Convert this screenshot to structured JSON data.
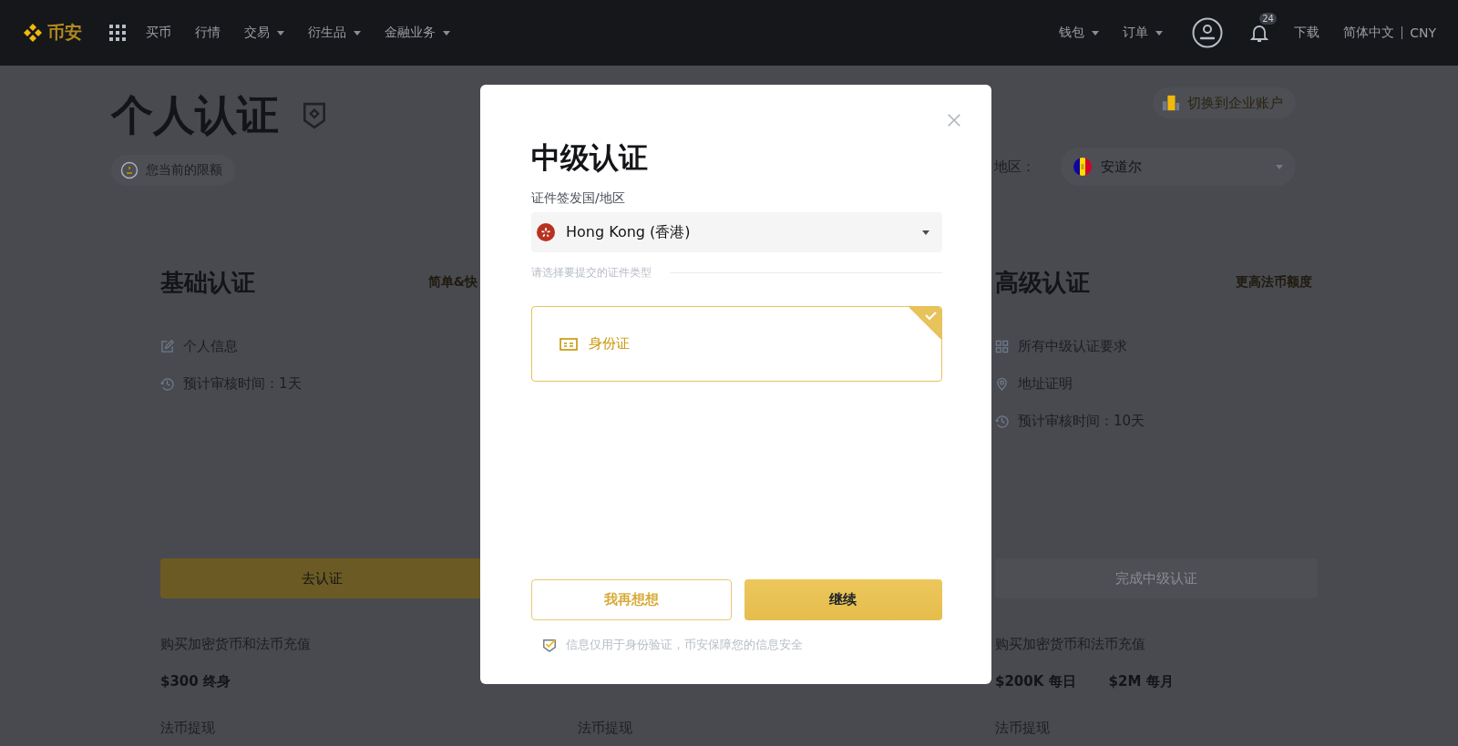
{
  "nav": {
    "logo": "币安",
    "menu": [
      {
        "label": "买币",
        "dropdown": false
      },
      {
        "label": "行情",
        "dropdown": false
      },
      {
        "label": "交易",
        "dropdown": true
      },
      {
        "label": "衍生品",
        "dropdown": true
      },
      {
        "label": "金融业务",
        "dropdown": true
      }
    ],
    "right_menu": [
      {
        "label": "钱包",
        "dropdown": true
      },
      {
        "label": "订单",
        "dropdown": true
      }
    ],
    "notification_count": "24",
    "download": "下载",
    "language": "简体中文",
    "currency": "CNY"
  },
  "page": {
    "title": "个人认证",
    "limit_chip": "您当前的限额",
    "switch_account": "切换到企业账户",
    "region_label": "地区：",
    "region_value": "安道尔"
  },
  "levels": [
    {
      "title": "基础认证",
      "tag": "简单&快",
      "requirements": [
        {
          "kind": "edit",
          "text": "个人信息"
        },
        {
          "kind": "clock",
          "text": "预计审核时间：1天"
        }
      ],
      "button": {
        "label": "去认证",
        "disabled": false
      },
      "limits_title": "购买加密货币和法币充值",
      "limits": [
        "$300 终身"
      ],
      "withdraw_title": "法币提现"
    },
    {
      "withdraw_title": "法币提现"
    },
    {
      "title": "高级认证",
      "tag": "更高法币额度",
      "requirements": [
        {
          "kind": "grid",
          "text": "所有中级认证要求"
        },
        {
          "kind": "pin",
          "text": "地址证明"
        },
        {
          "kind": "clock",
          "text": "预计审核时间：10天"
        }
      ],
      "button": {
        "label": "完成中级认证",
        "disabled": true
      },
      "limits_title": "购买加密货币和法币充值",
      "limits": [
        "$200K 每日",
        "$2M 每月"
      ],
      "withdraw_title": "法币提现"
    }
  ],
  "modal": {
    "title": "中级认证",
    "country_label": "证件签发国/地区",
    "country_value": "Hong Kong (香港)",
    "doc_type_label": "请选择要提交的证件类型",
    "documents": [
      {
        "label": "身份证",
        "selected": true
      }
    ],
    "buttons": [
      {
        "kind": "secondary",
        "label": "我再想想"
      },
      {
        "kind": "primary",
        "label": "继续"
      }
    ],
    "note": "信息仅用于身份验证，币安保障您的信息安全",
    "note_checked": true
  }
}
